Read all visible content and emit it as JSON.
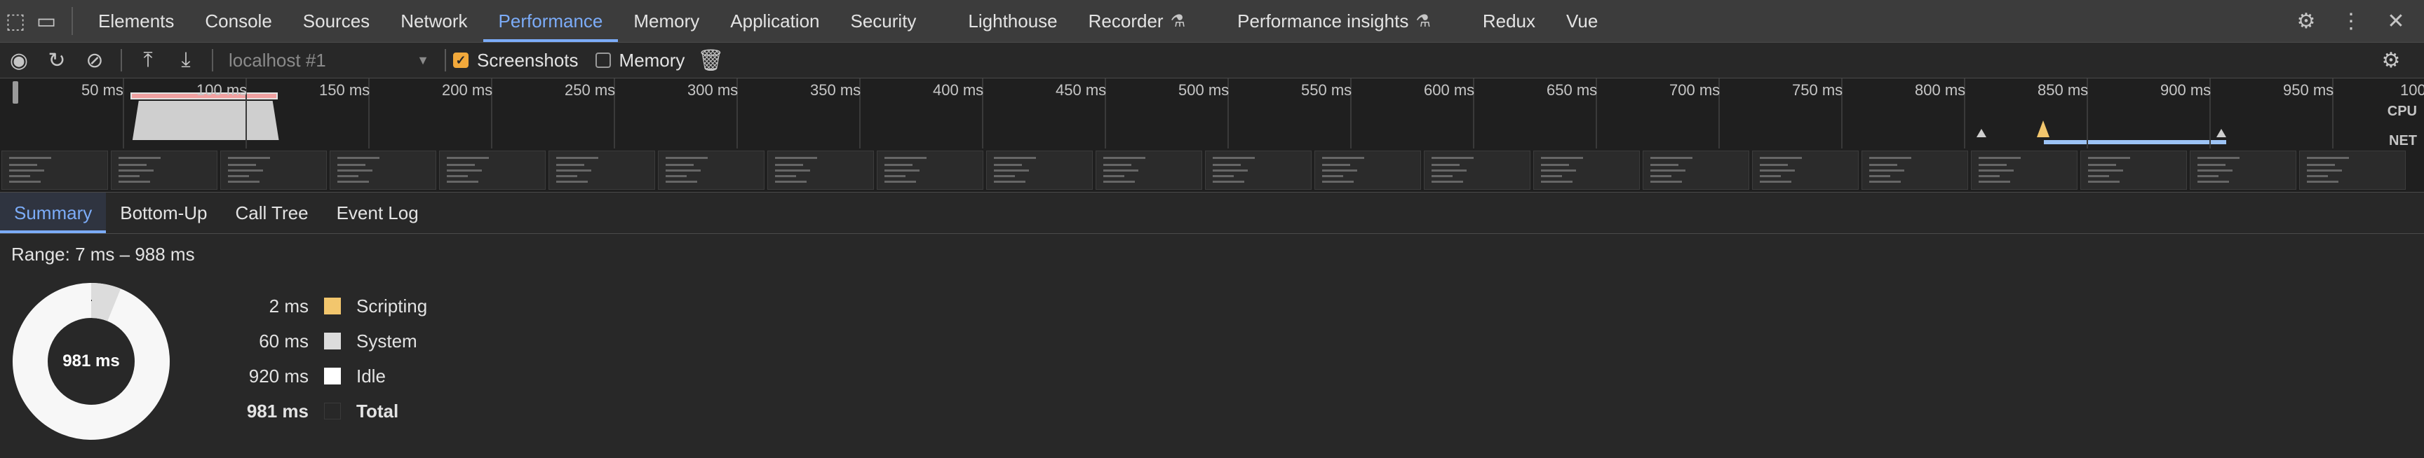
{
  "tabs": [
    {
      "label": "Elements"
    },
    {
      "label": "Console"
    },
    {
      "label": "Sources"
    },
    {
      "label": "Network"
    },
    {
      "label": "Performance"
    },
    {
      "label": "Memory"
    },
    {
      "label": "Application"
    },
    {
      "label": "Security"
    },
    {
      "label": "Lighthouse"
    },
    {
      "label": "Recorder"
    },
    {
      "label": "Performance insights"
    },
    {
      "label": "Redux"
    },
    {
      "label": "Vue"
    }
  ],
  "toolbar": {
    "session": "localhost #1",
    "screenshots_label": "Screenshots",
    "memory_label": "Memory"
  },
  "ruler": [
    "50 ms",
    "100 ms",
    "150 ms",
    "200 ms",
    "250 ms",
    "300 ms",
    "350 ms",
    "400 ms",
    "450 ms",
    "500 ms",
    "550 ms",
    "600 ms",
    "650 ms",
    "700 ms",
    "750 ms",
    "800 ms",
    "850 ms",
    "900 ms",
    "950 ms",
    "100"
  ],
  "tracks": {
    "cpu": "CPU",
    "net": "NET"
  },
  "subtabs": [
    {
      "label": "Summary"
    },
    {
      "label": "Bottom-Up"
    },
    {
      "label": "Call Tree"
    },
    {
      "label": "Event Log"
    }
  ],
  "summary": {
    "range": "Range: 7 ms – 988 ms",
    "center": "981 ms",
    "rows": [
      {
        "value": "2 ms",
        "name": "Scripting",
        "color": "#f2c66d"
      },
      {
        "value": "60 ms",
        "name": "System",
        "color": "#dcdcdc"
      },
      {
        "value": "920 ms",
        "name": "Idle",
        "color": "#ffffff"
      },
      {
        "value": "981 ms",
        "name": "Total",
        "color": "#282828"
      }
    ]
  }
}
